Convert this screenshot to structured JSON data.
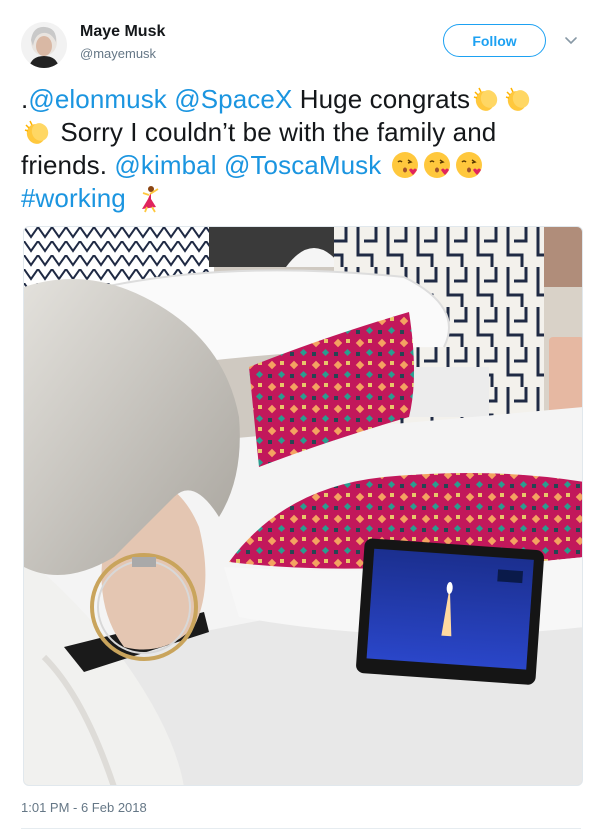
{
  "user": {
    "display_name": "Maye Musk",
    "screen_name": "@mayemusk"
  },
  "follow_label": "Follow",
  "tweet": {
    "prefix": ".",
    "mention_1": "@elonmusk",
    "mention_2": "@SpaceX",
    "text_1": " Huge congrats",
    "text_2": " Sorry I couldn’t be with the family and friends. ",
    "mention_3": "@kimbal",
    "mention_4": "@ToscaMusk",
    "hashtag": "#working",
    "emoji": [
      "clapping-hands",
      "clapping-hands",
      "clapping-hands",
      "face-blowing-kiss",
      "face-blowing-kiss",
      "face-blowing-kiss",
      "woman-dancing"
    ]
  },
  "timestamp": "1:01 PM - 6 Feb 2018",
  "colors": {
    "link": "#1b95e0",
    "follow_border": "#1da1f2",
    "meta": "#657786"
  }
}
